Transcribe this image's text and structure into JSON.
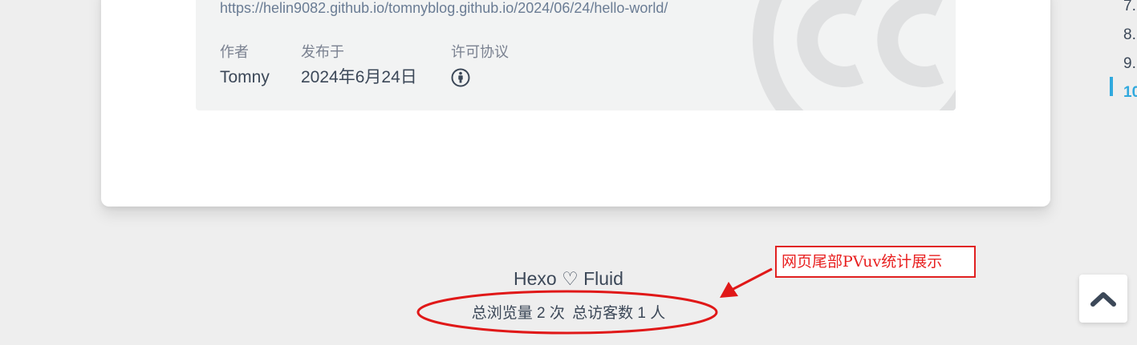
{
  "post": {
    "url": "https://helin9082.github.io/tomnyblog.github.io/2024/06/24/hello-world/",
    "meta": {
      "author_label": "作者",
      "author_value": "Tomny",
      "published_label": "发布于",
      "published_value": "2024年6月24日",
      "license_label": "许可协议"
    },
    "icons": {
      "license_icon": "cc-by-icon",
      "watermark": "cc-watermark-icon"
    }
  },
  "toc": {
    "items": [
      "7.",
      "8.",
      "9.",
      "10"
    ],
    "active_index": 3
  },
  "footer": {
    "brand": "Hexo ♡ Fluid",
    "pv_text": "总浏览量 2 次",
    "uv_text": "总访客数 1 人"
  },
  "annotation": {
    "label": "网页尾部PVuv统计展示"
  },
  "back_to_top": {
    "icon": "chevron-up-icon"
  },
  "colors": {
    "page_bg": "#eeeeee",
    "accent": "#30a9de",
    "annotation_red": "#e02020",
    "text": "#3c4858"
  }
}
